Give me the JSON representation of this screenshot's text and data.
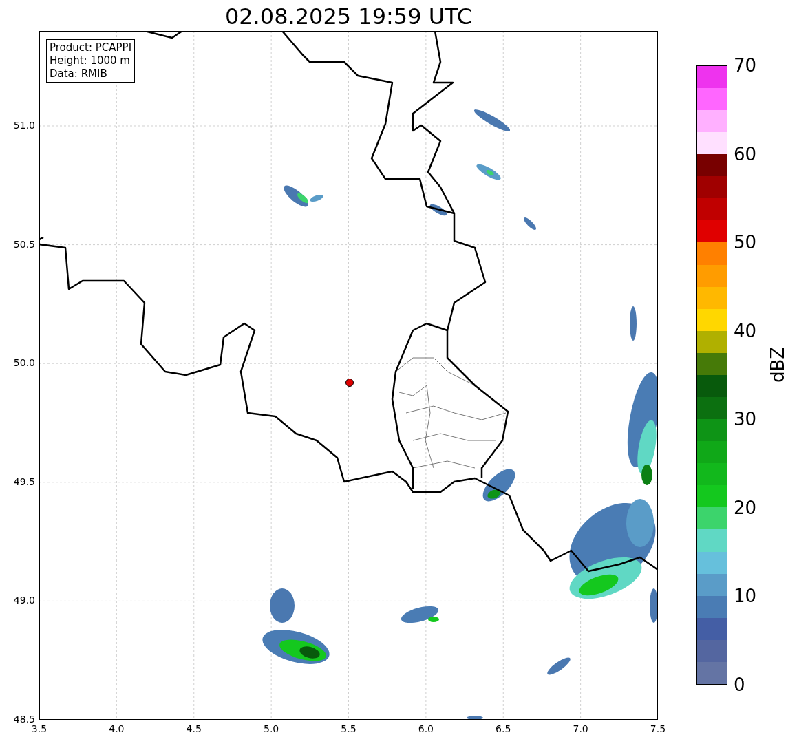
{
  "title": "02.08.2025 19:59 UTC",
  "info_box": [
    "Product: PCAPPI",
    "Height: 1000 m",
    "Data: RMIB"
  ],
  "x_ticks": [
    "3.5",
    "4.0",
    "4.5",
    "5.0",
    "5.5",
    "6.0",
    "6.5",
    "7.0",
    "7.5"
  ],
  "y_ticks": [
    "51.0",
    "50.5",
    "50.0",
    "49.5",
    "49.0",
    "48.5"
  ],
  "colorbar": {
    "label": "dBZ",
    "ticks": [
      "70",
      "60",
      "50",
      "40",
      "30",
      "20",
      "10",
      "0"
    ],
    "bands": [
      {
        "color": "#6474a4"
      },
      {
        "color": "#5466a0"
      },
      {
        "color": "#445ea5"
      },
      {
        "color": "#4a7cb4"
      },
      {
        "color": "#5a9cc8"
      },
      {
        "color": "#66c0dc"
      },
      {
        "color": "#60d8c4"
      },
      {
        "color": "#3cd46c"
      },
      {
        "color": "#14c81e"
      },
      {
        "color": "#12b81c"
      },
      {
        "color": "#10a818"
      },
      {
        "color": "#0e9416"
      },
      {
        "color": "#0c7010"
      },
      {
        "color": "#085a0c"
      },
      {
        "color": "#467a08"
      },
      {
        "color": "#b0b000"
      },
      {
        "color": "#ffd700"
      },
      {
        "color": "#ffb800"
      },
      {
        "color": "#ff9c00"
      },
      {
        "color": "#ff8000"
      },
      {
        "color": "#e00000"
      },
      {
        "color": "#c00000"
      },
      {
        "color": "#a00000"
      },
      {
        "color": "#780000"
      },
      {
        "color": "#ffe0ff"
      },
      {
        "color": "#ffb0ff"
      },
      {
        "color": "#ff66ff"
      },
      {
        "color": "#ee33ee"
      }
    ]
  }
}
